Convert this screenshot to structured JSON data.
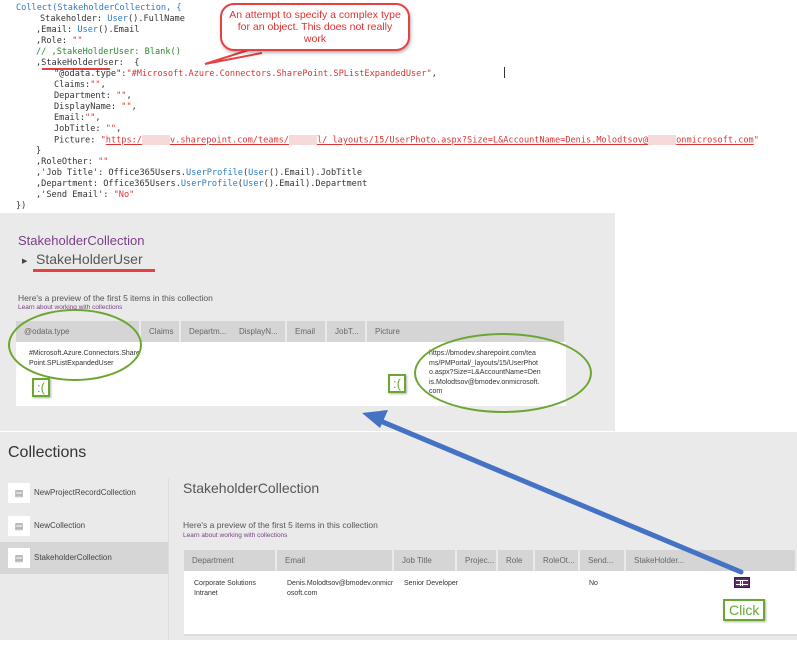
{
  "code": {
    "lines": [
      "Collect(StakeholderCollection, {",
      "Stakeholder: ",
      "User",
      "().FullName",
      ",Email: ",
      "User",
      "().Email",
      ",Role: ",
      "\"\"",
      "// ,StakeHolderUser: Blank()",
      ",StakeHolderUser:  {",
      "\"@odata.type\":",
      "\"#Microsoft.Azure.Connectors.SharePoint.SPListExpandedUser\"",
      ", ",
      "Claims:",
      "\"\"",
      ",",
      "Department: ",
      "\"\"",
      ",",
      "DisplayName: ",
      "\"\"",
      ",",
      "Email:",
      "\"\"",
      ",",
      "JobTitle: ",
      "\"\"",
      ",",
      "Picture: ",
      "\"",
      "https:/",
      "v.sharepoint.com/teams/",
      "l/_layouts/15/UserPhoto.aspx?Size=L&AccountName=Denis.Molodtsov@",
      "onmicrosoft.com",
      "\"",
      "}",
      ",RoleOther: ",
      "\"\"",
      ",'Job Title': Office365Users.",
      "UserProfile",
      "(",
      "User",
      "().Email).JobTitle",
      ",Department: Office365Users.",
      "UserProfile",
      "(",
      "User",
      "().Email).Department",
      ",'Send Email': ",
      "\"No\"",
      "})"
    ]
  },
  "callout": {
    "text": "An attempt to specify a complex type for an object. This does not really work"
  },
  "preview1": {
    "collection_title": "StakeholderCollection",
    "subtitle": "StakeHolderUser",
    "expand_icon": "triangle-right-icon",
    "preview_text": "Here's a preview of the first 5 items in this collection",
    "learn_link": "Learn about working with collections",
    "columns": [
      "@odata.type",
      "Claims",
      "Departm...",
      "DisplayN...",
      "Email",
      "JobT...",
      "Picture"
    ],
    "row": {
      "odata_type": "#Microsoft.Azure.Connectors.SharePoint.SPListExpandedUser",
      "picture": "https://bmodev.sharepoint.com/teams/PMPortal/_layouts/15/UserPhoto.aspx?Size=L&AccountName=Denis.Molodtsov@bmodev.onmicrosoft.com"
    },
    "sad1": ":(",
    "sad2": ":("
  },
  "collections": {
    "title": "Collections",
    "items": [
      {
        "label": "NewProjectRecordCollection"
      },
      {
        "label": "NewCollection"
      },
      {
        "label": "StakeholderCollection",
        "selected": true
      }
    ],
    "detail_title": "StakeholderCollection",
    "preview_text": "Here's a preview of the first 5 items in this collection",
    "learn_link": "Learn about working with collections",
    "columns": [
      "Department",
      "Email",
      "Job Title",
      "Projec...",
      "Role",
      "RoleOt...",
      "Send...",
      "StakeHolder..."
    ],
    "row": {
      "department": "Corporate Solutions Intranet",
      "email": "Denis.Molodtsov@bmodev.onmicrosoft.com",
      "job_title": "Senior Developer",
      "send_email": "No"
    },
    "click_label": "Click",
    "table_icon": "table-icon"
  },
  "colors": {
    "annotation_red": "#e84040",
    "annotation_green": "#6aa630",
    "arrow_blue": "#4472c4",
    "accent_purple": "#7a3f86"
  }
}
